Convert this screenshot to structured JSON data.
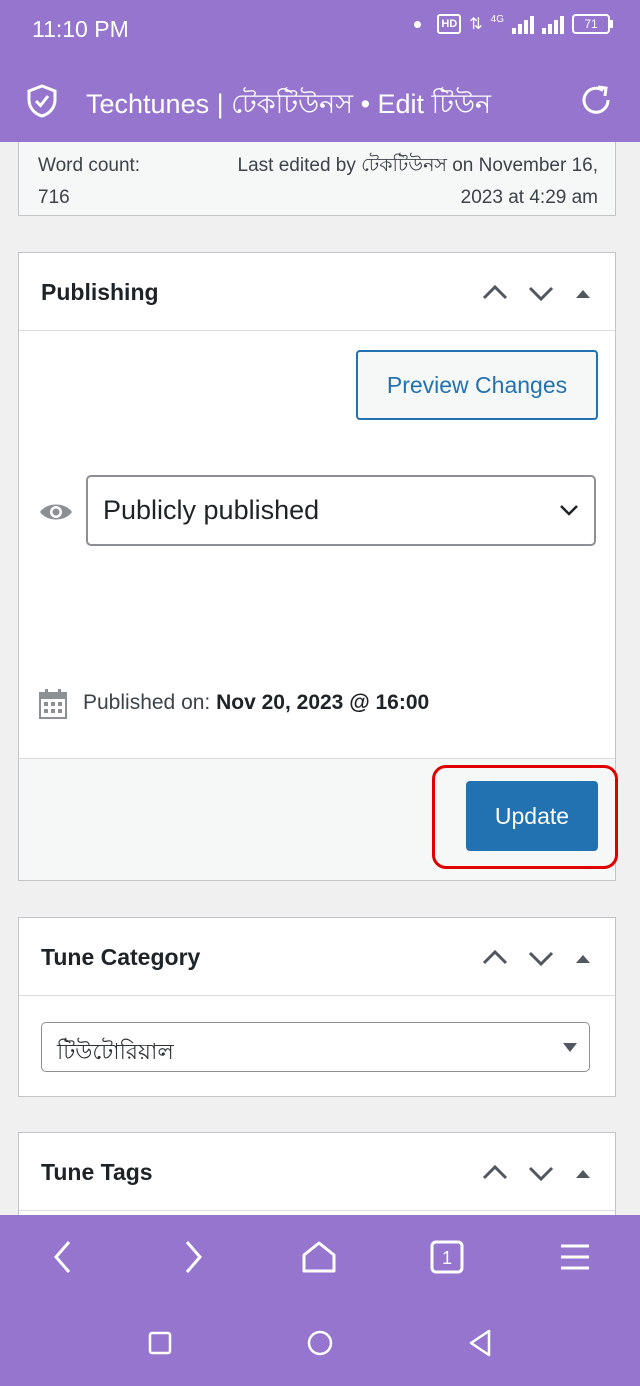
{
  "status_bar": {
    "time": "11:10 PM",
    "hd": "HD",
    "network": "4G",
    "battery": "71"
  },
  "app_bar": {
    "title": "Techtunes | টেকটিউনস • Edit টিউন",
    "icons": [
      "shield-check-icon",
      "reload-icon"
    ]
  },
  "summary": {
    "word_count_label": "Word count:",
    "word_count": "716",
    "last_edited": "Last edited by টেকটিউনস on November 16, 2023 at 4:29 am"
  },
  "publishing": {
    "title": "Publishing",
    "preview_label": "Preview Changes",
    "visibility_value": "Publicly published",
    "published_on_label": "Published on:",
    "published_on_value": "Nov 20, 2023 @ 16:00",
    "update_label": "Update"
  },
  "category": {
    "title": "Tune Category",
    "selected": "টিউটোরিয়াল"
  },
  "tags": {
    "title": "Tune Tags"
  },
  "colors": {
    "brand": "#9575cd",
    "primary": "#2271b1",
    "highlight": "#e00000"
  },
  "bottom_nav": [
    "back-icon",
    "forward-icon",
    "home-icon",
    "tabs-icon",
    "menu-icon"
  ],
  "tab_count": "1",
  "system_nav": [
    "recents-icon",
    "home-circle-icon",
    "back-triangle-icon"
  ]
}
